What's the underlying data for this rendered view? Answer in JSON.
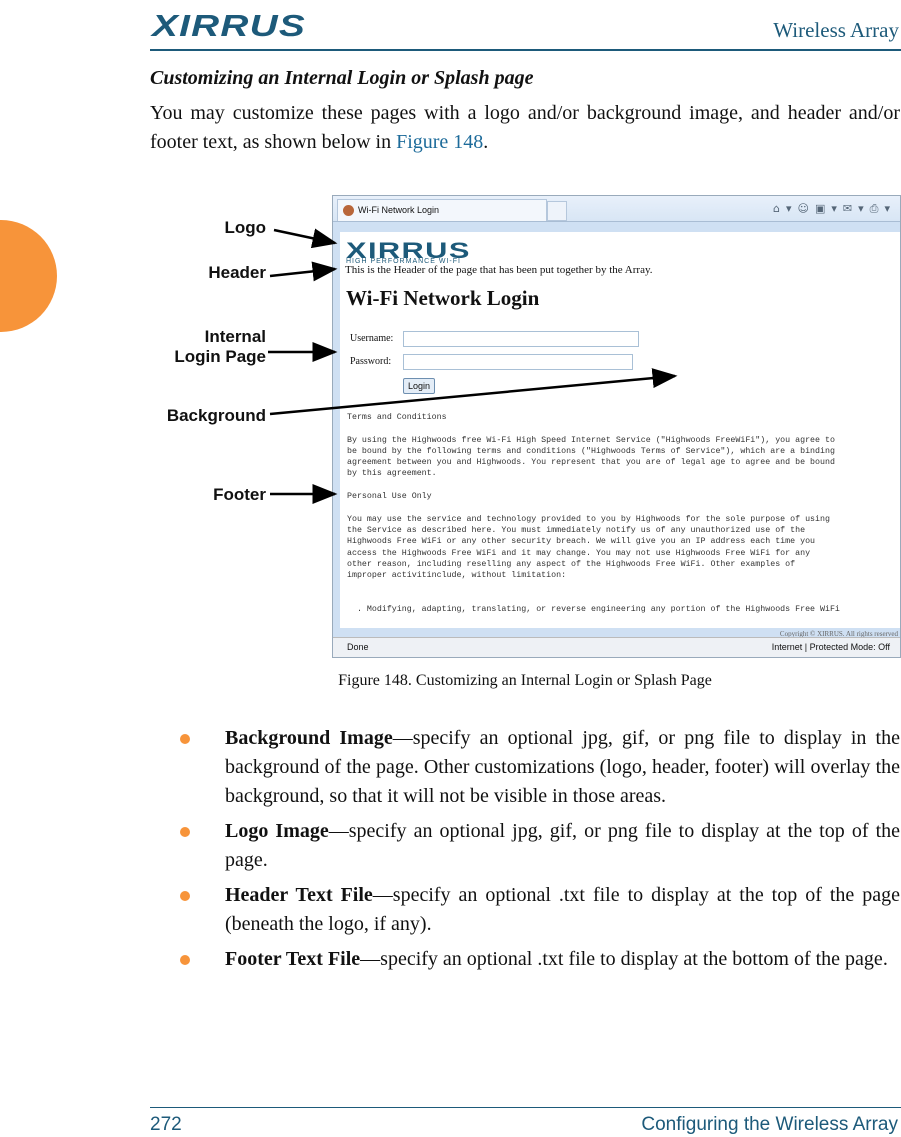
{
  "header": {
    "logo": "XIRRUS",
    "logo_mark": "®",
    "running_title": "Wireless Array"
  },
  "section": {
    "title": "Customizing an Internal Login or Splash page",
    "intro_before": "You may customize these pages with a logo and/or background image, and header and/or footer text, as shown below in ",
    "intro_link": "Figure 148",
    "intro_after": "."
  },
  "figure": {
    "callouts": {
      "logo": "Logo",
      "header": "Header",
      "internal1": "Internal",
      "internal2": "Login Page",
      "background": "Background",
      "footer": "Footer"
    },
    "browser": {
      "tab_title": "Wi-Fi Network Login",
      "logo": "XIRRUS",
      "logo_tagline": "HIGH PERFORMANCE WI-FI",
      "header_text": "This is the Header of the page that has been put together by the Array.",
      "page_title": "Wi-Fi Network Login",
      "username_label": "Username:",
      "password_label": "Password:",
      "username_value": "",
      "password_value": "",
      "login_button": "Login",
      "terms": "Terms and Conditions\n\nBy using the Highwoods free Wi-Fi High Speed Internet Service (\"Highwoods FreeWiFi\"), you agree to\nbe bound by the following terms and conditions (\"Highwoods Terms of Service\"), which are a binding\nagreement between you and Highwoods. You represent that you are of legal age to agree and be bound\nby this agreement.\n\nPersonal Use Only\n\nYou may use the service and technology provided to you by Highwoods for the sole purpose of using\nthe Service as described here. You must immediately notify us of any unauthorized use of the\nHighwoods Free WiFi or any other security breach. We will give you an IP address each time you\naccess the Highwoods Free WiFi and it may change. You may not use Highwoods Free WiFi for any\nother reason, including reselling any aspect of the Highwoods Free WiFi. Other examples of\nimproper activitinclude, without limitation:\n\n\n  . Modifying, adapting, translating, or reverse engineering any portion of the Highwoods Free WiFi",
      "copyright": "Copyright © XIRRUS. All rights reserved",
      "status_left": "Done",
      "status_right": "Internet | Protected Mode: Off"
    },
    "caption": "Figure 148. Customizing an Internal Login or Splash Page"
  },
  "bullets": [
    {
      "term": "Background Image",
      "text": "—specify an optional jpg, gif, or png file to display in the background of the page. Other customizations (logo, header, footer) will overlay the background, so that it will not be visible in those areas."
    },
    {
      "term": "Logo Image",
      "text": "—specify an optional jpg, gif, or png file to display at the top of the page."
    },
    {
      "term": "Header Text File",
      "text": "—specify an optional .txt file to display at the top of the page (beneath the logo, if any)."
    },
    {
      "term": "Footer Text File",
      "text": "—specify an optional .txt file to display at the bottom of the page."
    }
  ],
  "footer": {
    "page_number": "272",
    "chapter": "Configuring the Wireless Array"
  },
  "colors": {
    "brand": "#1d5a7a",
    "accent": "#f7943a"
  }
}
